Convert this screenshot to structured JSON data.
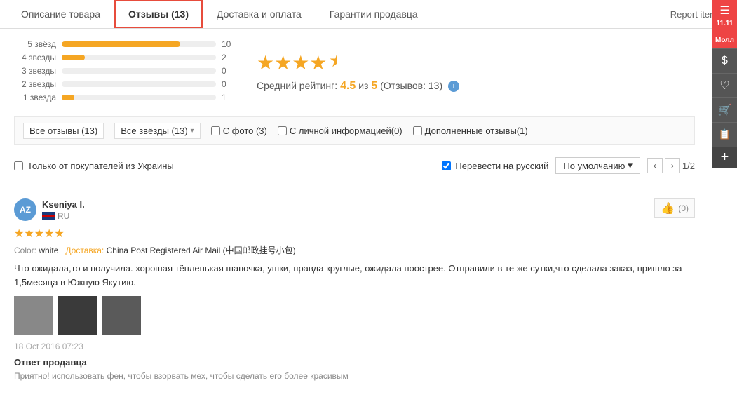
{
  "tabs": [
    {
      "id": "description",
      "label": "Описание товара",
      "active": false
    },
    {
      "id": "reviews",
      "label": "Отзывы (13)",
      "active": true
    },
    {
      "id": "delivery",
      "label": "Доставка и оплата",
      "active": false
    },
    {
      "id": "seller",
      "label": "Гарантии продавца",
      "active": false
    }
  ],
  "report_item": "Report item",
  "rating": {
    "bars": [
      {
        "label": "5 звёзд",
        "count": 10,
        "percent": 77
      },
      {
        "label": "4 звезды",
        "count": 2,
        "percent": 15
      },
      {
        "label": "3 звезды",
        "count": 0,
        "percent": 0
      },
      {
        "label": "2 звезды",
        "count": 0,
        "percent": 0
      },
      {
        "label": "1 звезда",
        "count": 1,
        "percent": 8
      }
    ],
    "stars_display": "★★★★½",
    "average": "4.5",
    "out_of": "5",
    "review_count": "13",
    "avg_label": "Средний рейтинг:",
    "out_of_label": "из",
    "reviews_label": "Отзывов:"
  },
  "filters": {
    "all_reviews_label": "Все отзывы (13)",
    "all_stars_label": "Все звёзды (13)",
    "with_photo_label": "С фото (3)",
    "with_info_label": "С личной информацией(0)",
    "additional_label": "Дополненные отзывы(1)"
  },
  "options": {
    "ukraine_only_label": "Только от покупателей из Украины",
    "translate_label": "Перевести на русский",
    "sort_label": "По умолчанию",
    "page_current": "1",
    "page_total": "2"
  },
  "reviews": [
    {
      "id": "kseniya",
      "avatar_initials": "AZ",
      "name": "Kseniya I.",
      "country": "RU",
      "stars": 5,
      "color_label": "Color:",
      "color_value": "white",
      "delivery_label": "Доставка:",
      "delivery_value": "China Post Registered Air Mail (中国邮政挂号小包)",
      "text": "Что ожидала,то и получила. хорошая тёпленькая шапочка, ушки, правда круглые, ожидала поострее. Отправили в те же сутки,что сделала заказ, пришло за 1,5месяца в Южную Якутию.",
      "images": [
        {
          "id": "img1",
          "color": "#888"
        },
        {
          "id": "img2",
          "color": "#3a3a3a"
        },
        {
          "id": "img3",
          "color": "#5a5a5a"
        }
      ],
      "date": "18 Oct 2016 07:23",
      "likes": "0",
      "seller_response_title": "Ответ продавца",
      "seller_response_text": "Приятно! использовать фен, чтобы взорвать мех, чтобы сделать его более красивым"
    }
  ],
  "sidebar": {
    "promo_label": "11.11",
    "cart_icon": "🛒",
    "heart_icon": "♡",
    "clipboard_icon": "📋",
    "dollar_icon": "$",
    "add_icon": "+"
  }
}
